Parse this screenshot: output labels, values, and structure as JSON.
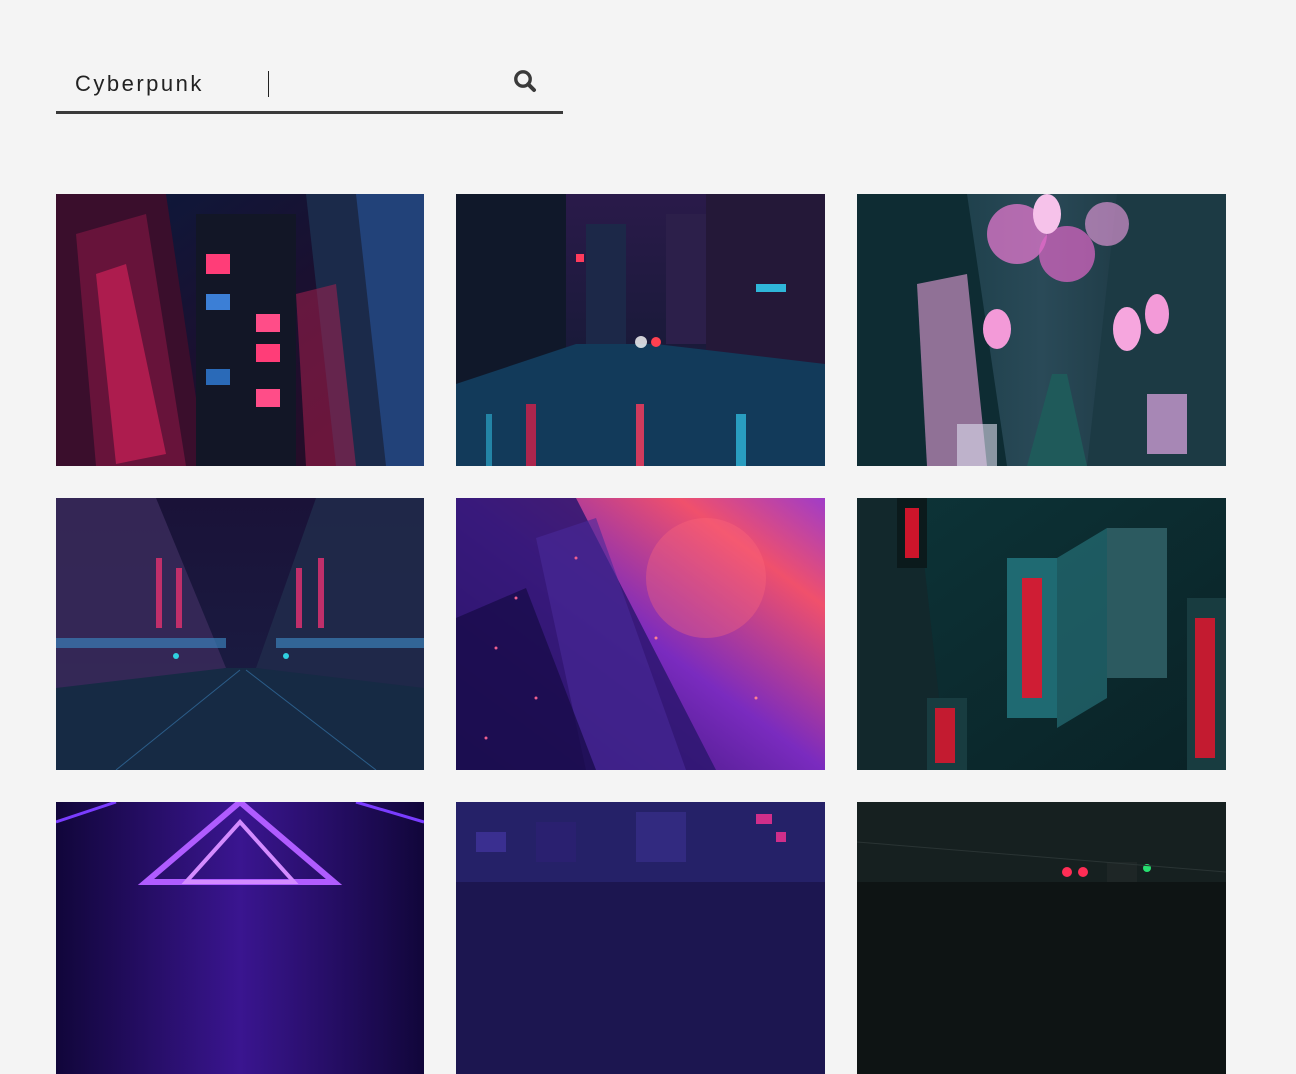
{
  "search": {
    "value": "Cyberpunk",
    "icon": "search-icon"
  },
  "gallery": {
    "items": [
      {
        "name": "image-neon-apartment",
        "palette": [
          "#0c1430",
          "#e8245f",
          "#2a5aa8"
        ]
      },
      {
        "name": "image-rainy-street",
        "palette": [
          "#0f1c3a",
          "#d3204a",
          "#2fb6d9"
        ]
      },
      {
        "name": "image-lantern-alley",
        "palette": [
          "#173a44",
          "#f07ad6",
          "#0e2c33"
        ]
      },
      {
        "name": "image-night-avenue",
        "palette": [
          "#1a1238",
          "#3a7fb8",
          "#c02f6a"
        ]
      },
      {
        "name": "image-purple-abstract",
        "palette": [
          "#2d1670",
          "#f0506c",
          "#7a2bbf"
        ]
      },
      {
        "name": "image-teal-signs",
        "palette": [
          "#0d3438",
          "#e2152e",
          "#1f6a72"
        ]
      },
      {
        "name": "image-violet-tunnel",
        "palette": [
          "#2a0f6e",
          "#b05cff",
          "#11063a"
        ]
      },
      {
        "name": "image-city-aerial",
        "palette": [
          "#1c1650",
          "#d02e8a",
          "#2c2a78"
        ]
      },
      {
        "name": "image-dark-crossing",
        "palette": [
          "#0e1414",
          "#ff2d55",
          "#27e070"
        ]
      }
    ]
  }
}
